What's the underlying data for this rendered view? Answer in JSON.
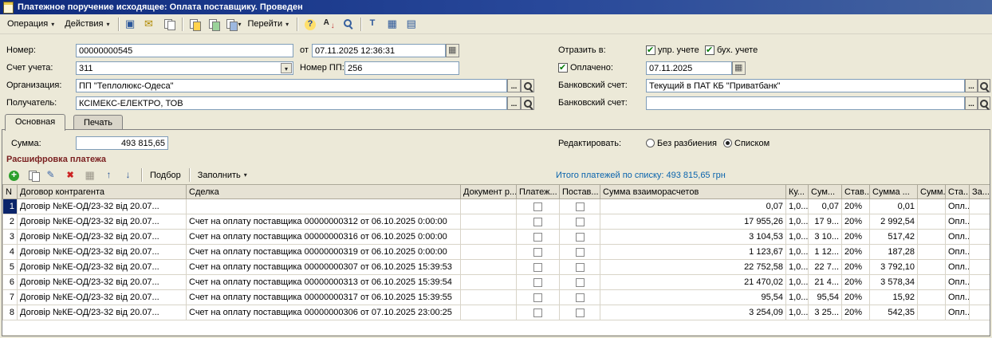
{
  "window": {
    "title": "Платежное поручение исходящее: Оплата поставщику. Проведен"
  },
  "toolbar": {
    "operation": "Операция",
    "actions": "Действия",
    "goto": "Перейти"
  },
  "icons": {
    "document-icon": "sheet",
    "dropdown-caret-icon": "▾",
    "form-icon": "▣",
    "mail-icon": "✉",
    "copy-icon": "two-sheets",
    "documents-icon": "stacked-sheets",
    "help-icon": "?",
    "sort-icon": "А↓",
    "magnifier-icon": "magnifier",
    "pin-icon": "Т",
    "table-icon": "▦",
    "structure-icon": "▤",
    "add-icon": "+",
    "edit-icon": "✎",
    "delete-icon": "✖",
    "move-up-icon": "↑",
    "move-down-icon": "↓",
    "browse-icon": "...",
    "calendar-icon": "grid",
    "checkbox-check": "✔"
  },
  "form": {
    "number": {
      "label": "Номер:",
      "value": "00000000545"
    },
    "date": {
      "label": "от",
      "value": "07.11.2025 12:36:31"
    },
    "account": {
      "label": "Счет учета:",
      "value": "311"
    },
    "pp": {
      "label": "Номер ПП:",
      "value": "256"
    },
    "organization": {
      "label": "Организация:",
      "value": "ПП \"Теплолюкс-Одеса\""
    },
    "recipient": {
      "label": "Получатель:",
      "value": "КСІМЕКС-ЕЛЕКТРО, ТОВ"
    },
    "reflect": {
      "label": "Отразить в:",
      "upr": "упр. учете",
      "buh": "бух. учете"
    },
    "paid": {
      "label": "Оплачено:",
      "value": "07.11.2025"
    },
    "bank1": {
      "label": "Банковский счет:",
      "value": "Текущий в ПАТ КБ \"Приватбанк\""
    },
    "bank2": {
      "label": "Банковский счет:",
      "value": ""
    }
  },
  "tabs": {
    "main": "Основная",
    "print": "Печать"
  },
  "summary": {
    "label": "Сумма:",
    "value": "493 815,65"
  },
  "edit_mode": {
    "label": "Редактировать:",
    "no_split": "Без разбиения",
    "as_list": "Списком"
  },
  "details": {
    "title": "Расшифровка платежа",
    "pick": "Подбор",
    "fill": "Заполнить",
    "total": "Итого платежей по списку: 493 815,65 грн"
  },
  "table": {
    "columns": [
      "N",
      "Договор контрагента",
      "Сделка",
      "Документ р...",
      "Платеж...",
      "Постав...",
      "Сумма взаиморасчетов",
      "Ку...",
      "Сум...",
      "Став...",
      "Сумма ...",
      "Сумм...",
      "Ста...",
      "За..."
    ],
    "rows": [
      {
        "n": "1",
        "contract": "Договір №КЕ-ОД/23-32 від 20.07...",
        "deal": "",
        "document": "",
        "amount": "0,07",
        "k": "1,0...",
        "amount2": "0,07",
        "vat_rate": "20%",
        "vat": "0,01",
        "sum2": "",
        "status": "Опл...",
        "extra": ""
      },
      {
        "n": "2",
        "contract": "Договір №КЕ-ОД/23-32 від 20.07...",
        "deal": "Счет на оплату поставщика 00000000312 от 06.10.2025 0:00:00",
        "document": "",
        "amount": "17 955,26",
        "k": "1,0...",
        "amount2": "17 9...",
        "vat_rate": "20%",
        "vat": "2 992,54",
        "sum2": "",
        "status": "Опл...",
        "extra": ""
      },
      {
        "n": "3",
        "contract": "Договір №КЕ-ОД/23-32 від 20.07...",
        "deal": "Счет на оплату поставщика 00000000316 от 06.10.2025 0:00:00",
        "document": "",
        "amount": "3 104,53",
        "k": "1,0...",
        "amount2": "3 10...",
        "vat_rate": "20%",
        "vat": "517,42",
        "sum2": "",
        "status": "Опл...",
        "extra": ""
      },
      {
        "n": "4",
        "contract": "Договір №КЕ-ОД/23-32 від 20.07...",
        "deal": "Счет на оплату поставщика 00000000319 от 06.10.2025 0:00:00",
        "document": "",
        "amount": "1 123,67",
        "k": "1,0...",
        "amount2": "1 12...",
        "vat_rate": "20%",
        "vat": "187,28",
        "sum2": "",
        "status": "Опл...",
        "extra": ""
      },
      {
        "n": "5",
        "contract": "Договір №КЕ-ОД/23-32 від 20.07...",
        "deal": "Счет на оплату поставщика 00000000307 от 06.10.2025 15:39:53",
        "document": "",
        "amount": "22 752,58",
        "k": "1,0...",
        "amount2": "22 7...",
        "vat_rate": "20%",
        "vat": "3 792,10",
        "sum2": "",
        "status": "Опл...",
        "extra": ""
      },
      {
        "n": "6",
        "contract": "Договір №КЕ-ОД/23-32 від 20.07...",
        "deal": "Счет на оплату поставщика 00000000313 от 06.10.2025 15:39:54",
        "document": "",
        "amount": "21 470,02",
        "k": "1,0...",
        "amount2": "21 4...",
        "vat_rate": "20%",
        "vat": "3 578,34",
        "sum2": "",
        "status": "Опл...",
        "extra": ""
      },
      {
        "n": "7",
        "contract": "Договір №КЕ-ОД/23-32 від 20.07...",
        "deal": "Счет на оплату поставщика 00000000317 от 06.10.2025 15:39:55",
        "document": "",
        "amount": "95,54",
        "k": "1,0...",
        "amount2": "95,54",
        "vat_rate": "20%",
        "vat": "15,92",
        "sum2": "",
        "status": "Опл...",
        "extra": ""
      },
      {
        "n": "8",
        "contract": "Договір №КЕ-ОД/23-32 від 20.07...",
        "deal": "Счет на оплату поставщика 00000000306 от 07.10.2025 23:00:25",
        "document": "",
        "amount": "3 254,09",
        "k": "1,0...",
        "amount2": "3 25...",
        "vat_rate": "20%",
        "vat": "542,35",
        "sum2": "",
        "status": "Опл...",
        "extra": ""
      }
    ]
  }
}
